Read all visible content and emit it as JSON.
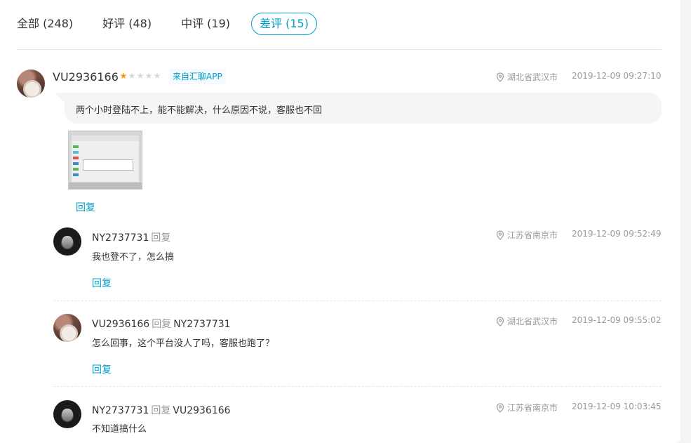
{
  "tabs": [
    {
      "label": "全部 (248)",
      "active": false
    },
    {
      "label": "好评 (48)",
      "active": false
    },
    {
      "label": "中评 (19)",
      "active": false
    },
    {
      "label": "差评 (15)",
      "active": true
    }
  ],
  "comment": {
    "user": "VU2936166",
    "rating": 1,
    "rating_max": 5,
    "source": "来自汇聊APP",
    "location": "湖北省武汉市",
    "time": "2019-12-09 09:27:10",
    "text": "两个小时登陆不上，能不能解决，什么原因不说，客服也不回",
    "reply_label": "回复"
  },
  "replies": [
    {
      "user": "NY2737731",
      "verb": "回复",
      "target": "",
      "location": "江苏省南京市",
      "time": "2019-12-09 09:52:49",
      "text": "我也登不了，怎么搞",
      "reply_label": "回复"
    },
    {
      "user": "VU2936166",
      "verb": "回复",
      "target": "NY2737731",
      "location": "湖北省武汉市",
      "time": "2019-12-09 09:55:02",
      "text": "怎么回事，这个平台没人了吗，客服也跑了？",
      "reply_label": "回复"
    },
    {
      "user": "NY2737731",
      "verb": "回复",
      "target": "VU2936166",
      "location": "江苏省南京市",
      "time": "2019-12-09 10:03:45",
      "text": "不知道搞什么",
      "reply_label": ""
    }
  ],
  "colors": {
    "accent": "#00a0c8",
    "star_on": "#ff9000",
    "star_off": "#d8d8d8",
    "muted": "#999999"
  },
  "icons": {
    "location": "location-pin-icon",
    "star": "star-icon"
  }
}
